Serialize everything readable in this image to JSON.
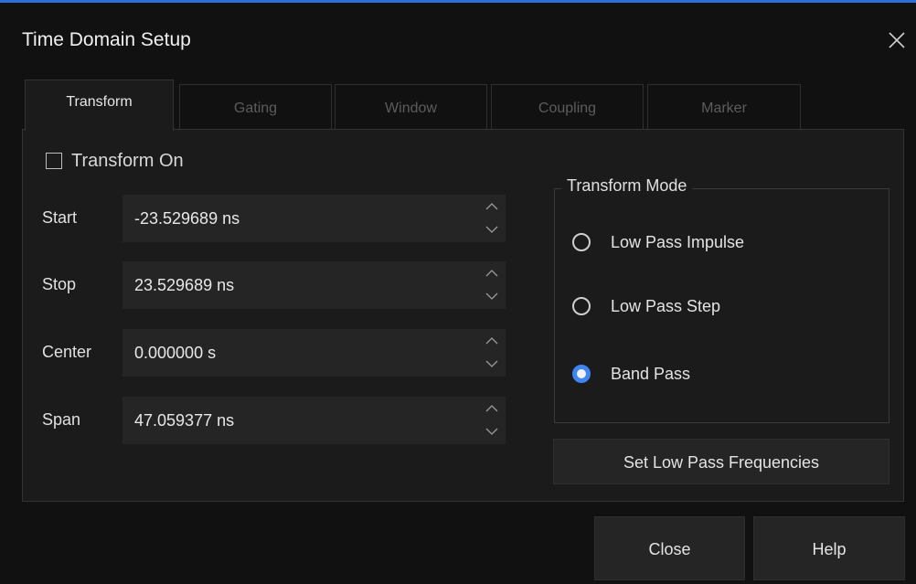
{
  "dialog": {
    "title": "Time Domain Setup"
  },
  "tabs": [
    {
      "label": "Transform",
      "active": true
    },
    {
      "label": "Gating",
      "active": false
    },
    {
      "label": "Window",
      "active": false
    },
    {
      "label": "Coupling",
      "active": false
    },
    {
      "label": "Marker",
      "active": false
    }
  ],
  "transform_on": {
    "label": "Transform On",
    "checked": false
  },
  "fields": {
    "start": {
      "label": "Start",
      "value": "-23.529689 ns"
    },
    "stop": {
      "label": "Stop",
      "value": "23.529689 ns"
    },
    "center": {
      "label": "Center",
      "value": "0.000000 s"
    },
    "span": {
      "label": "Span",
      "value": "47.059377 ns"
    }
  },
  "transform_mode": {
    "title": "Transform Mode",
    "options": [
      {
        "label": "Low Pass Impulse",
        "selected": false
      },
      {
        "label": "Low Pass Step",
        "selected": false
      },
      {
        "label": "Band Pass",
        "selected": true
      }
    ]
  },
  "buttons": {
    "set_low_pass": "Set Low Pass Frequencies",
    "close": "Close",
    "help": "Help"
  },
  "colors": {
    "accent": "#3f86f0",
    "background": "#111111",
    "panel": "#1b1b1b",
    "field": "#252525"
  }
}
